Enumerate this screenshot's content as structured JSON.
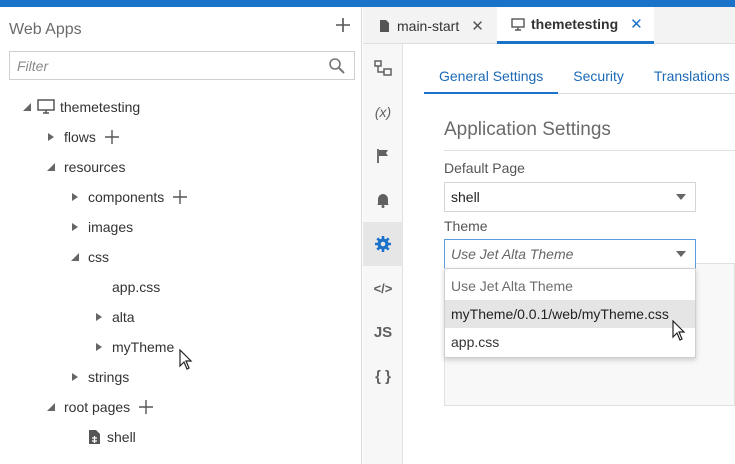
{
  "navigator": {
    "title": "Web Apps",
    "filter_placeholder": "Filter",
    "tree": [
      {
        "label": "themetesting"
      },
      {
        "label": "flows"
      },
      {
        "label": "resources"
      },
      {
        "label": "components"
      },
      {
        "label": "images"
      },
      {
        "label": "css"
      },
      {
        "label": "app.css"
      },
      {
        "label": "alta"
      },
      {
        "label": "myTheme"
      },
      {
        "label": "strings"
      },
      {
        "label": "root pages"
      },
      {
        "label": "shell"
      }
    ]
  },
  "tabs": [
    {
      "label": "main-start",
      "icon": "file-icon"
    },
    {
      "label": "themetesting",
      "icon": "monitor-icon",
      "active": true
    }
  ],
  "rail": [
    {
      "icon": "structure-icon"
    },
    {
      "icon": "variables-icon",
      "text": "(x)"
    },
    {
      "icon": "flag-icon"
    },
    {
      "icon": "bell-icon"
    },
    {
      "icon": "gear-icon",
      "active": true
    },
    {
      "icon": "code-icon",
      "text": "</>"
    },
    {
      "icon": "js-icon",
      "text": "JS"
    },
    {
      "icon": "json-icon",
      "text": "{ }"
    }
  ],
  "subtabs": [
    "General Settings",
    "Security",
    "Translations"
  ],
  "settings": {
    "section_title": "Application Settings",
    "default_page_label": "Default Page",
    "default_page_value": "shell",
    "theme_label": "Theme",
    "theme_value": "Use Jet Alta Theme",
    "theme_options": [
      "Use Jet Alta Theme",
      "myTheme/0.0.1/web/myTheme.css",
      "app.css"
    ]
  },
  "colors": {
    "accent": "#1a73c9",
    "link": "#1b6ab8"
  }
}
